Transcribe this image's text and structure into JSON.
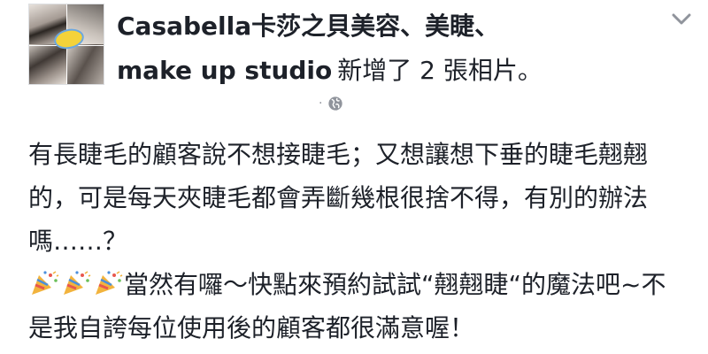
{
  "post": {
    "author_line1": "Casabella卡莎之貝美容、美睫、",
    "author_line2": "make up studio",
    "action": "新增了 2 張相片。",
    "separator": "·",
    "privacy_icon": "globe-icon",
    "menu_icon": "chevron-down-icon"
  },
  "body": {
    "paragraph1": "有長睫毛的顧客說不想接睫毛；又想讓想下垂的睫毛翹翹的，可是每天夾睫毛都會弄斷幾根很捨不得，有別的辦法嗎……？",
    "emoji_icons": [
      "party-popper-icon",
      "party-popper-icon",
      "party-popper-icon"
    ],
    "paragraph2": "當然有囉～快點來預約試試“翹翹睫“的魔法吧~不是我自誇每位使用後的顧客都很滿意喔！"
  },
  "colors": {
    "text": "#1d2129",
    "meta": "#90949c",
    "background": "#ffffff"
  }
}
